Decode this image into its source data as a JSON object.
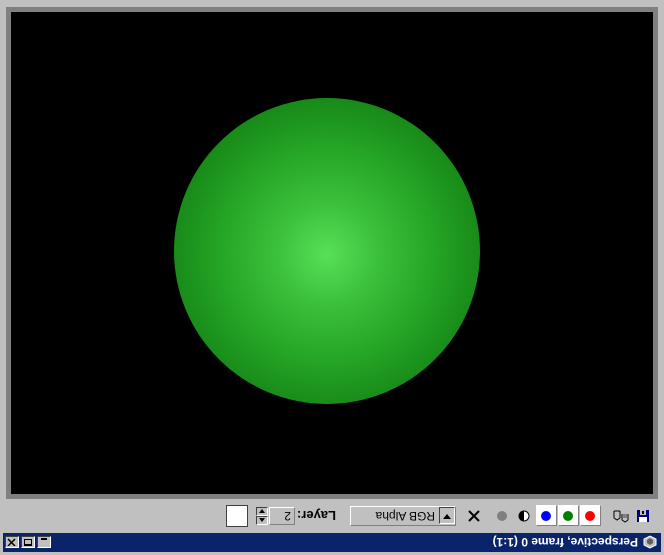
{
  "window": {
    "title": "Perspective, frame 0 (1:1)"
  },
  "toolbar": {
    "channel": "RGB Alpha",
    "layer_label": "Layer:",
    "layer_value": "2"
  },
  "colors": {
    "titlebar": "#0a246a",
    "chrome": "#c0c0c0",
    "viewport_bg": "#000000",
    "sphere": "#26a626",
    "red": "#ff0000",
    "green": "#008000",
    "blue": "#0000ff"
  },
  "icons": [
    "app-icon",
    "save-icon",
    "clone-icon",
    "red-channel-icon",
    "green-channel-icon",
    "blue-channel-icon",
    "mono-icon",
    "alpha-dot-icon",
    "clear-icon",
    "dropdown-arrow-icon",
    "spinner-icon"
  ]
}
